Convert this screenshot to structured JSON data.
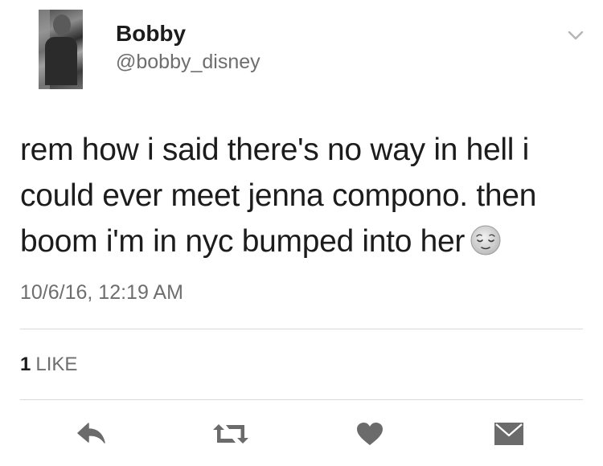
{
  "tweet": {
    "display_name": "Bobby",
    "handle": "@bobby_disney",
    "text_lines": [
      "rem how i said there's no way in hell i",
      "could ever meet jenna compono. then",
      "boom i'm in nyc bumped into her"
    ],
    "emoji": "relieved-face-emoji",
    "timestamp": "10/6/16, 12:19 AM",
    "likes_count": "1",
    "likes_label": "LIKE"
  },
  "icons": {
    "menu": "chevron-down-icon",
    "reply": "reply-icon",
    "retweet": "retweet-icon",
    "like": "heart-icon",
    "message": "envelope-icon"
  },
  "colors": {
    "text": "#1c1c1c",
    "secondary": "#6e6e6e",
    "icon": "#6b6b6b",
    "divider": "#d9d9d9"
  }
}
